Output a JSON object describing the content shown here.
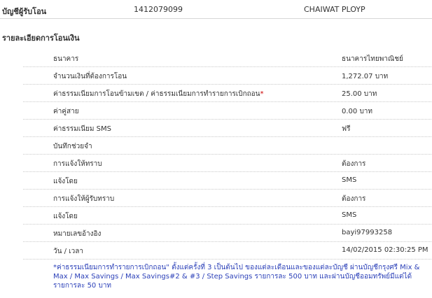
{
  "recipient": {
    "label": "บัญชีผู้รับโอน",
    "account_no": "1412079099",
    "name": "CHAIWAT PLOYP"
  },
  "section_title": "รายละเอียดการโอนเงิน",
  "rows": [
    {
      "label": "ธนาคาร",
      "value": "ธนาคารไทยพาณิชย์"
    },
    {
      "label": "จำนวนเงินที่ต้องการโอน",
      "value": "1,272.07 บาท"
    },
    {
      "label": "ค่าธรรมเนียมการโอนข้ามเขต / ค่าธรรมเนียมการทำรายการเบิกถอน",
      "marker": "*",
      "value": "25.00 บาท"
    },
    {
      "label": "ค่าคู่สาย",
      "value": "0.00 บาท"
    },
    {
      "label": "ค่าธรรมเนียม SMS",
      "value": "ฟรี"
    },
    {
      "label": "บันทึกช่วยจำ",
      "value": ""
    },
    {
      "label": "การแจ้งให้ทราบ",
      "value": "ต้องการ"
    },
    {
      "label": "แจ้งโดย",
      "value": "SMS"
    },
    {
      "label": "การแจ้งให้ผู้รับทราบ",
      "value": "ต้องการ"
    },
    {
      "label": "แจ้งโดย",
      "value": "SMS"
    },
    {
      "label": "หมายเลขอ้างอิง",
      "value": "bayi97993258"
    },
    {
      "label": "วัน / เวลา",
      "value": "14/02/2015 02:30:25 PM"
    }
  ],
  "footnote": "*ค่าธรรมเนียมการทำรายการเบิกถอน\" ตั้งแต่ครั้งที่ 3 เป็นต้นไป ของแต่ละเดือนและของแต่ละบัญชี ผ่านบัญชีกรุงศรี Mix & Max / Max Savings / Max Savings#2 & #3 / Step Savings รายการละ 500 บาท และผ่านบัญชีออมทรัพย์มีแต่ได้ รายการละ 50 บาท",
  "colors": {
    "footnote": "#2a3fb8",
    "required_marker": "#cc0000"
  }
}
